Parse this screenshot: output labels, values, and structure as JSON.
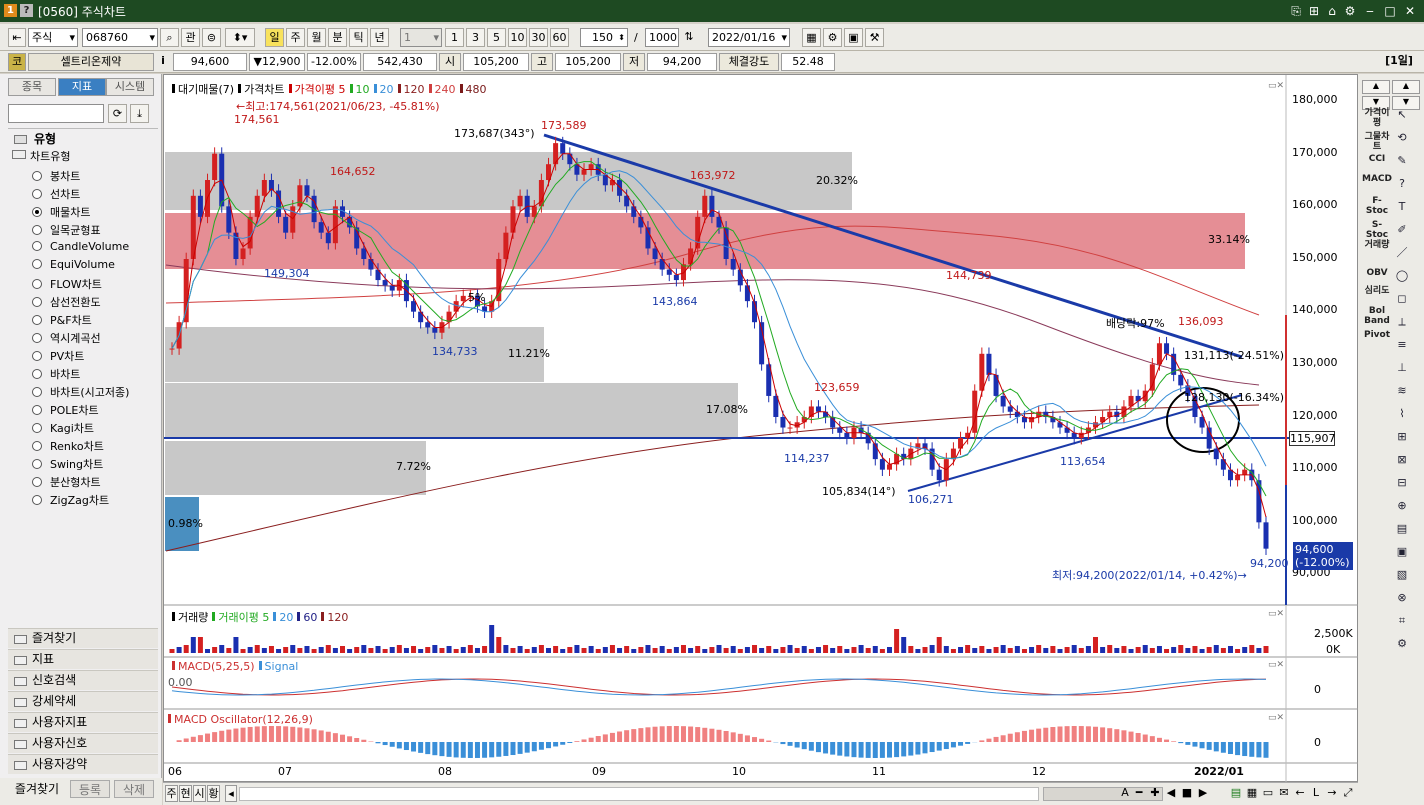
{
  "window": {
    "id_label": "[0560]",
    "title": "주식차트",
    "icon1": "1",
    "icon2": "?"
  },
  "toolbar": {
    "market": "주식",
    "code": "068760",
    "gwan": "관",
    "periods": [
      "일",
      "주",
      "월",
      "분",
      "틱",
      "년"
    ],
    "interval_select": "1",
    "quick_intervals": [
      "1",
      "3",
      "5",
      "10",
      "30",
      "60"
    ],
    "count": "150",
    "slash": "/",
    "max_count": "1000",
    "date": "2022/01/16"
  },
  "quote": {
    "market_badge": "코",
    "name": "셀트리온제약",
    "info": "i",
    "price": "94,600",
    "change": "▼12,900",
    "change_pct": "-12.00%",
    "volume": "542,430",
    "open_label": "시",
    "open": "105,200",
    "high_label": "고",
    "high": "105,200",
    "low_label": "저",
    "low": "94,200",
    "strength_label": "체결강도",
    "strength": "52.48",
    "period_badge": "[1일]"
  },
  "left": {
    "tabs": [
      "종목",
      "지표",
      "시스템"
    ],
    "section_title": "유형",
    "tree_label": "차트유형",
    "chart_types": [
      "봉차트",
      "선차트",
      "매물차트",
      "일목균형표",
      "CandleVolume",
      "EquiVolume",
      "FLOW차트",
      "삼선전환도",
      "P&F차트",
      "역시계곡선",
      "PV차트",
      "바차트",
      "바차트(시고저종)",
      "POLE차트",
      "Kagi차트",
      "Renko차트",
      "Swing차트",
      "분산형차트",
      "ZigZag차트"
    ],
    "selected_index": 2,
    "folders": [
      "즐겨찾기",
      "지표",
      "신호검색",
      "강세약세",
      "사용자지표",
      "사용자신호",
      "사용자강약"
    ],
    "bottom_buttons": [
      "즐겨찾기",
      "등록",
      "삭제"
    ]
  },
  "chart": {
    "legend_main": [
      {
        "text": "대기매물(7)",
        "color": "#000000"
      },
      {
        "text": "가격차트",
        "color": "#000000"
      },
      {
        "text": "가격이평 5",
        "color": "#cc0000"
      },
      {
        "text": "10",
        "color": "#22aa22"
      },
      {
        "text": "20",
        "color": "#3a8fd8"
      },
      {
        "text": "120",
        "color": "#8a1e1e"
      },
      {
        "text": "240",
        "color": "#d04040"
      },
      {
        "text": "480",
        "color": "#7a1a1a"
      }
    ],
    "price_axis": [
      "180,000",
      "170,000",
      "160,000",
      "150,000",
      "140,000",
      "130,000",
      "120,000",
      "110,000",
      "100,000",
      "90,000"
    ],
    "price_marker": "115,907",
    "current_price": "94,600",
    "current_pct": "(-12.00%)",
    "annotations": {
      "high_note": "←최고:174,561(2021/06/23, -45.81%)",
      "low_note": "최저:94,200(2022/01/14, +0.42%)→",
      "p1": "174,561",
      "p2": "164,652",
      "p3": "149,304",
      "p4": "134,733",
      "p5": "173,589",
      "p6": "173,687(343°)",
      "p7": "163,972",
      "p8": "143,864",
      "p9": "144,739",
      "p10": "123,659",
      "p11": "114,237",
      "p12": "105,834(14°)",
      "p13": "106,271",
      "p14": "113,654",
      "p15": "배당락:97%",
      "p16": "136,093",
      "p17": "131,113(-24.51%)",
      "p18": "128,130(-16.34%)",
      "p19": "94,200",
      "p20": "5%"
    },
    "volume_profile": [
      "20.32%",
      "33.14%",
      "11.21%",
      "17.08%",
      "7.72%",
      "0.98%"
    ],
    "volume_legend": [
      {
        "text": "거래량",
        "color": "#000000"
      },
      {
        "text": "거래이평 5",
        "color": "#22aa22"
      },
      {
        "text": "20",
        "color": "#3a8fd8"
      },
      {
        "text": "60",
        "color": "#222288"
      },
      {
        "text": "120",
        "color": "#8a1e1e"
      }
    ],
    "volume_axis": [
      "2,500K",
      "0K"
    ],
    "macd_legend": [
      {
        "text": "MACD(5,25,5)",
        "color": "#cc3030"
      },
      {
        "text": "Signal",
        "color": "#3a8fd8"
      }
    ],
    "macd_value": "0.00",
    "macd_axis": "0",
    "osc_legend": "MACD Oscillator(12,26,9)",
    "osc_axis": "0",
    "x_labels": [
      "06",
      "07",
      "08",
      "09",
      "10",
      "11",
      "12",
      "2022/01"
    ]
  },
  "right": {
    "labels": [
      "가격이평",
      "그물차트",
      "CCI",
      "MACD",
      "F-Stoc",
      "S-Stoc",
      "거래량",
      "OBV",
      "심리도",
      "Bol Band",
      "Pivot"
    ]
  },
  "bottom": {
    "tabs": [
      "주",
      "현",
      "시",
      "황"
    ]
  }
}
